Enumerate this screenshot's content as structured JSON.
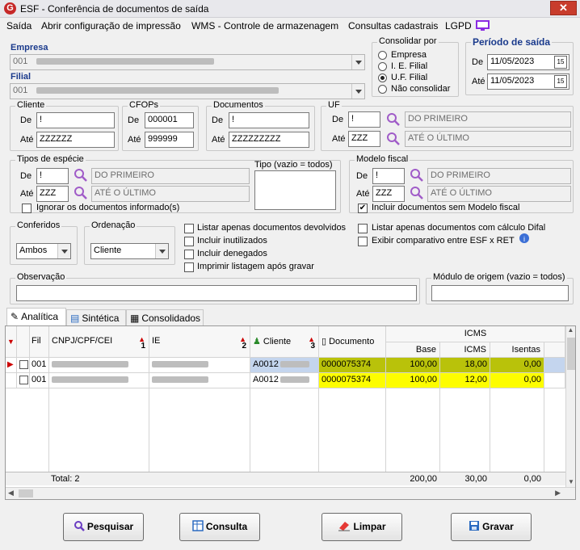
{
  "window": {
    "title": "ESF - Conferência de documentos de saída",
    "logo": "G",
    "close": "✕"
  },
  "menu": [
    "Saída",
    "Abrir configuração de impressão",
    "WMS - Controle de armazenagem",
    "Consultas cadastrais",
    "LGPD"
  ],
  "empresa": {
    "label": "Empresa",
    "value": "001"
  },
  "filial": {
    "label": "Filial",
    "value": "001"
  },
  "consolidar": {
    "label": "Consolidar por",
    "options": [
      "Empresa",
      "I. E. Filial",
      "U.F. Filial",
      "Não consolidar"
    ],
    "selected": "U.F. Filial"
  },
  "periodo": {
    "label": "Período de saída",
    "de_label": "De",
    "de": "11/05/2023",
    "ate_label": "Até",
    "ate": "11/05/2023"
  },
  "cliente": {
    "label": "Cliente",
    "de": "!",
    "ate": "ZZZZZZ"
  },
  "cfops": {
    "label": "CFOPs",
    "de": "000001",
    "ate": "999999"
  },
  "documentos": {
    "label": "Documentos",
    "de": "!",
    "ate": "ZZZZZZZZZ"
  },
  "uf": {
    "label": "UF",
    "de": "!",
    "de_desc": "DO PRIMEIRO",
    "ate": "ZZZ",
    "ate_desc": "ATÉ O ÚLTIMO"
  },
  "tipos_especie": {
    "label": "Tipos de espécie",
    "de": "!",
    "de_desc": "DO PRIMEIRO",
    "ate": "ZZZ",
    "ate_desc": "ATÉ O ÚLTIMO",
    "ignorar": "Ignorar os documentos informado(s)",
    "tipo_label": "Tipo (vazio = todos)"
  },
  "modelo_fiscal": {
    "label": "Modelo fiscal",
    "de": "!",
    "de_desc": "DO PRIMEIRO",
    "ate": "ZZZ",
    "ate_desc": "ATÉ O ÚLTIMO",
    "incluir": "Incluir documentos sem Modelo fiscal"
  },
  "labels": {
    "de": "De",
    "ate": "Até"
  },
  "conferidos": {
    "label": "Conferidos",
    "value": "Ambos"
  },
  "ordenacao": {
    "label": "Ordenação",
    "value": "Cliente"
  },
  "checks": {
    "devolvidos": "Listar apenas documentos devolvidos",
    "inutilizados": "Incluir inutilizados",
    "denegados": "Incluir denegados",
    "imprimir": "Imprimir listagem após gravar",
    "difal": "Listar apenas documentos com cálculo Difal",
    "comparativo": "Exibir comparativo entre ESF x  RET"
  },
  "observacao": {
    "label": "Observação"
  },
  "modulo": {
    "label": "Módulo de origem (vazio = todos)"
  },
  "tabs": [
    "Analítica",
    "Sintética",
    "Consolidados"
  ],
  "grid": {
    "headers": {
      "fil": "Fil",
      "cnpj": "CNPJ/CPF/CEI",
      "cnpj_sort": "1",
      "ie": "IE",
      "ie_sort": "2",
      "cliente": "Cliente",
      "cliente_sort": "3",
      "documento": "Documento",
      "icms": "ICMS",
      "base": "Base",
      "icms_col": "ICMS",
      "isentas": "Isentas"
    },
    "rows": [
      {
        "fil": "001",
        "cliente": "A0012",
        "documento": "0000075374",
        "base": "100,00",
        "icms": "18,00",
        "isentas": "0,00"
      },
      {
        "fil": "001",
        "cliente": "A0012",
        "documento": "0000075374",
        "base": "100,00",
        "icms": "12,00",
        "isentas": "0,00"
      }
    ],
    "total_label": "Total: 2",
    "totals": {
      "base": "200,00",
      "icms": "30,00",
      "isentas": "0,00"
    }
  },
  "buttons": {
    "pesquisar": "Pesquisar",
    "consulta": "Consulta",
    "limpar": "Limpar",
    "gravar": "Gravar"
  },
  "colors": {
    "accent_blue": "#1a3a8c",
    "highlight_yellow": "#fdfd00",
    "highlight_olive": "#b9c20a",
    "title_red": "#c62828"
  }
}
